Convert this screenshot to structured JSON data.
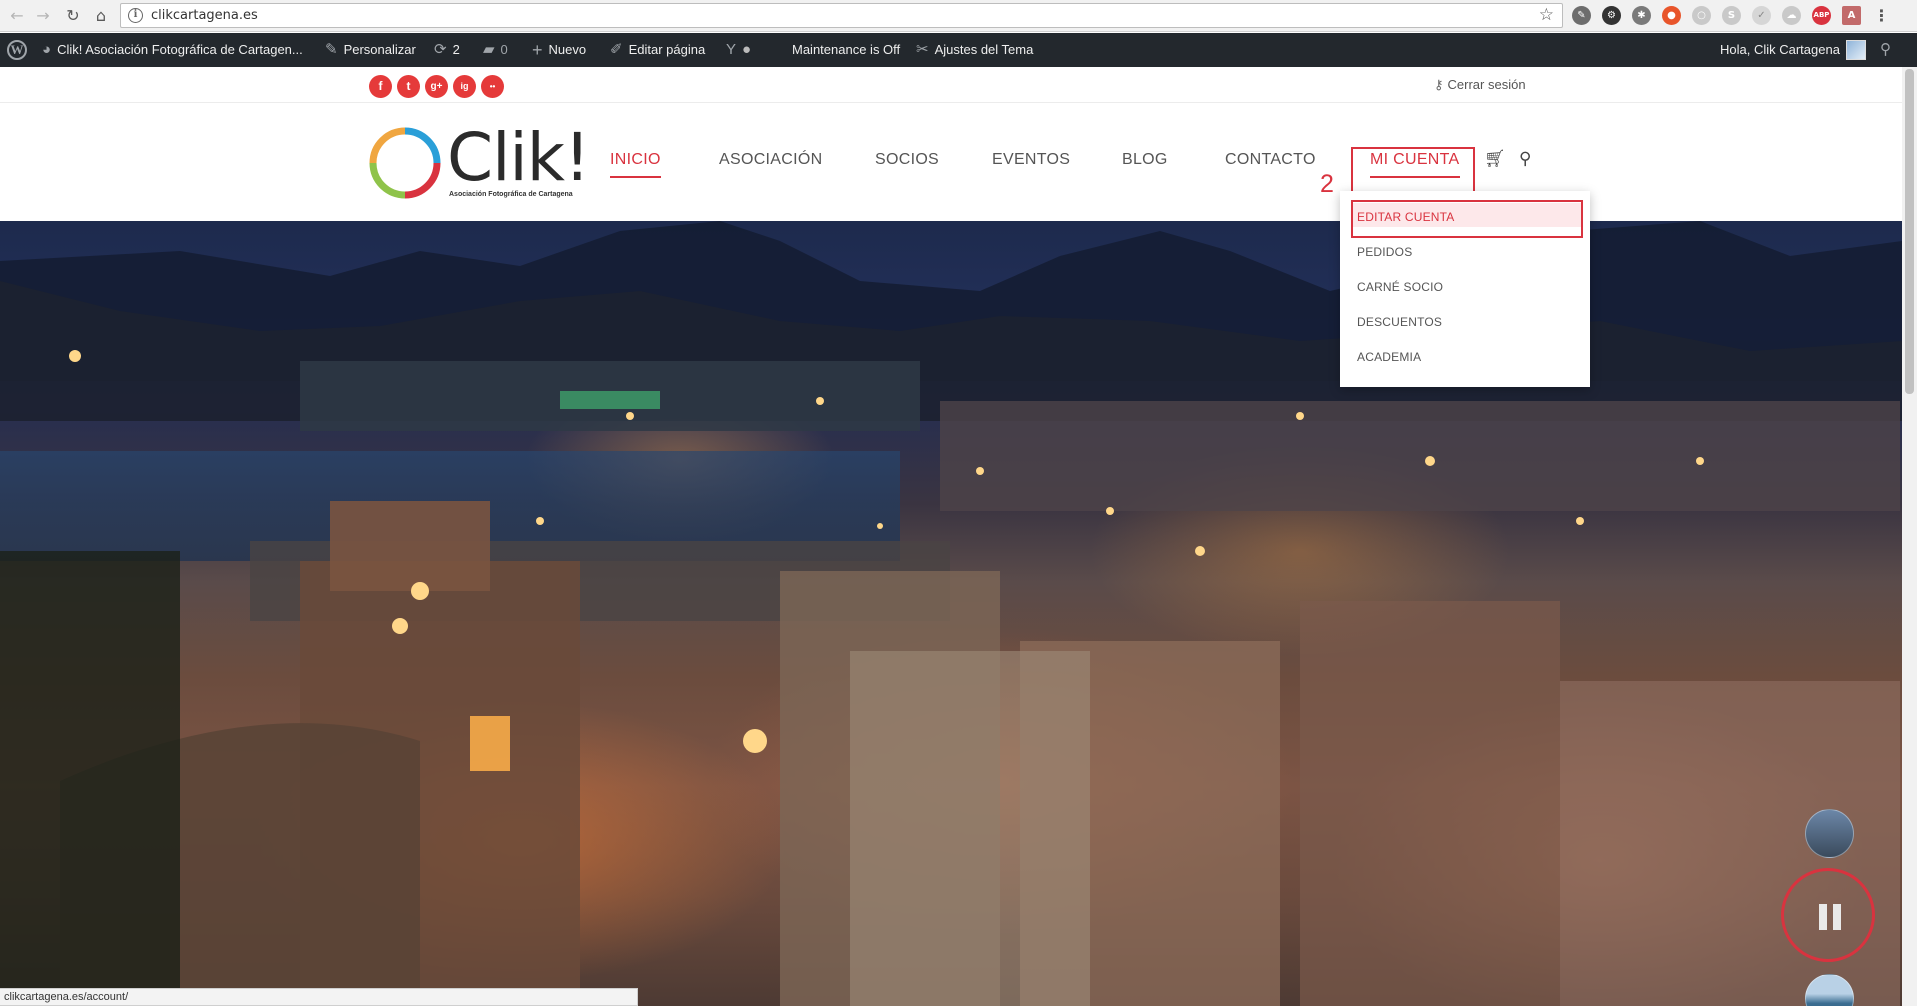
{
  "browser": {
    "url": "clikcartagena.es",
    "status_url": "clikcartagena.es/account/"
  },
  "admin_bar": {
    "site_name": "Clik! Asociación Fotográfica de Cartagen...",
    "customize": "Personalizar",
    "updates_count": "2",
    "comments_count": "0",
    "new": "Nuevo",
    "edit_page": "Editar página",
    "maintenance": "Maintenance is Off",
    "theme_settings": "Ajustes del Tema",
    "greeting": "Hola, Clik Cartagena"
  },
  "top_bar": {
    "social": [
      "f",
      "t",
      "g+",
      "ig",
      "••"
    ],
    "logout": "Cerrar sesión"
  },
  "logo": {
    "brand": "Clik!",
    "tagline": "Asociación Fotográfica de Cartagena"
  },
  "menu": {
    "items": [
      "INICIO",
      "ASOCIACIÓN",
      "SOCIOS",
      "EVENTOS",
      "BLOG",
      "CONTACTO",
      "MI CUENTA"
    ]
  },
  "annotation": {
    "number": "2"
  },
  "dropdown": {
    "items": [
      "EDITAR CUENTA",
      "PEDIDOS",
      "CARNÉ SOCIO",
      "DESCUENTOS",
      "ACADEMIA"
    ]
  },
  "colors": {
    "accent": "#d9333f",
    "admin_bar": "#23282d"
  }
}
